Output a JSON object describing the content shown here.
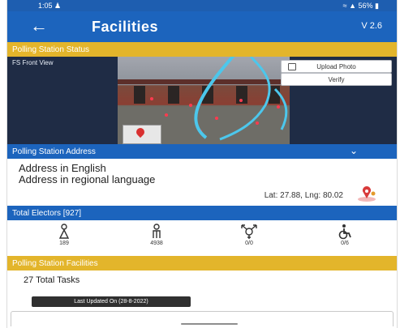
{
  "status_bar": {
    "time": "1:05",
    "icons": [
      "person-icon"
    ],
    "right_text": "56%"
  },
  "app_bar": {
    "back_icon": "arrow-left-icon",
    "title": "Facilities",
    "version": "V 2.6"
  },
  "polling_station_status": {
    "label": "Polling Station Status",
    "front_view_label": "FS Front View"
  },
  "photo_actions": {
    "upload_label": "Upload Photo",
    "verify_label": "Verify"
  },
  "polling_station_address": {
    "label": "Polling Station Address",
    "collapse_icon": "chevron-down-icon",
    "address_english": "Address in English",
    "address_regional": "Address in regional language",
    "lat_lng": "Lat: 27.88, Lng: 80.02",
    "map_icon": "map-pin-icon"
  },
  "total_electors": {
    "label": "Total Electors [927]",
    "categories": [
      {
        "icon": "female-icon",
        "count": "189"
      },
      {
        "icon": "senior-icon",
        "count": "4938"
      },
      {
        "icon": "transgender-icon",
        "count": "0/0"
      },
      {
        "icon": "wheelchair-icon",
        "count": "0/6"
      }
    ]
  },
  "polling_station_facilities": {
    "label": "Polling Station Facilities",
    "total_tasks": "27 Total Tasks",
    "last_updated": "Last Updated On (28-8-2022)"
  },
  "colors": {
    "primary": "#1c64bd",
    "accent": "#e3b52b",
    "dark_panel": "#1f2c45"
  }
}
